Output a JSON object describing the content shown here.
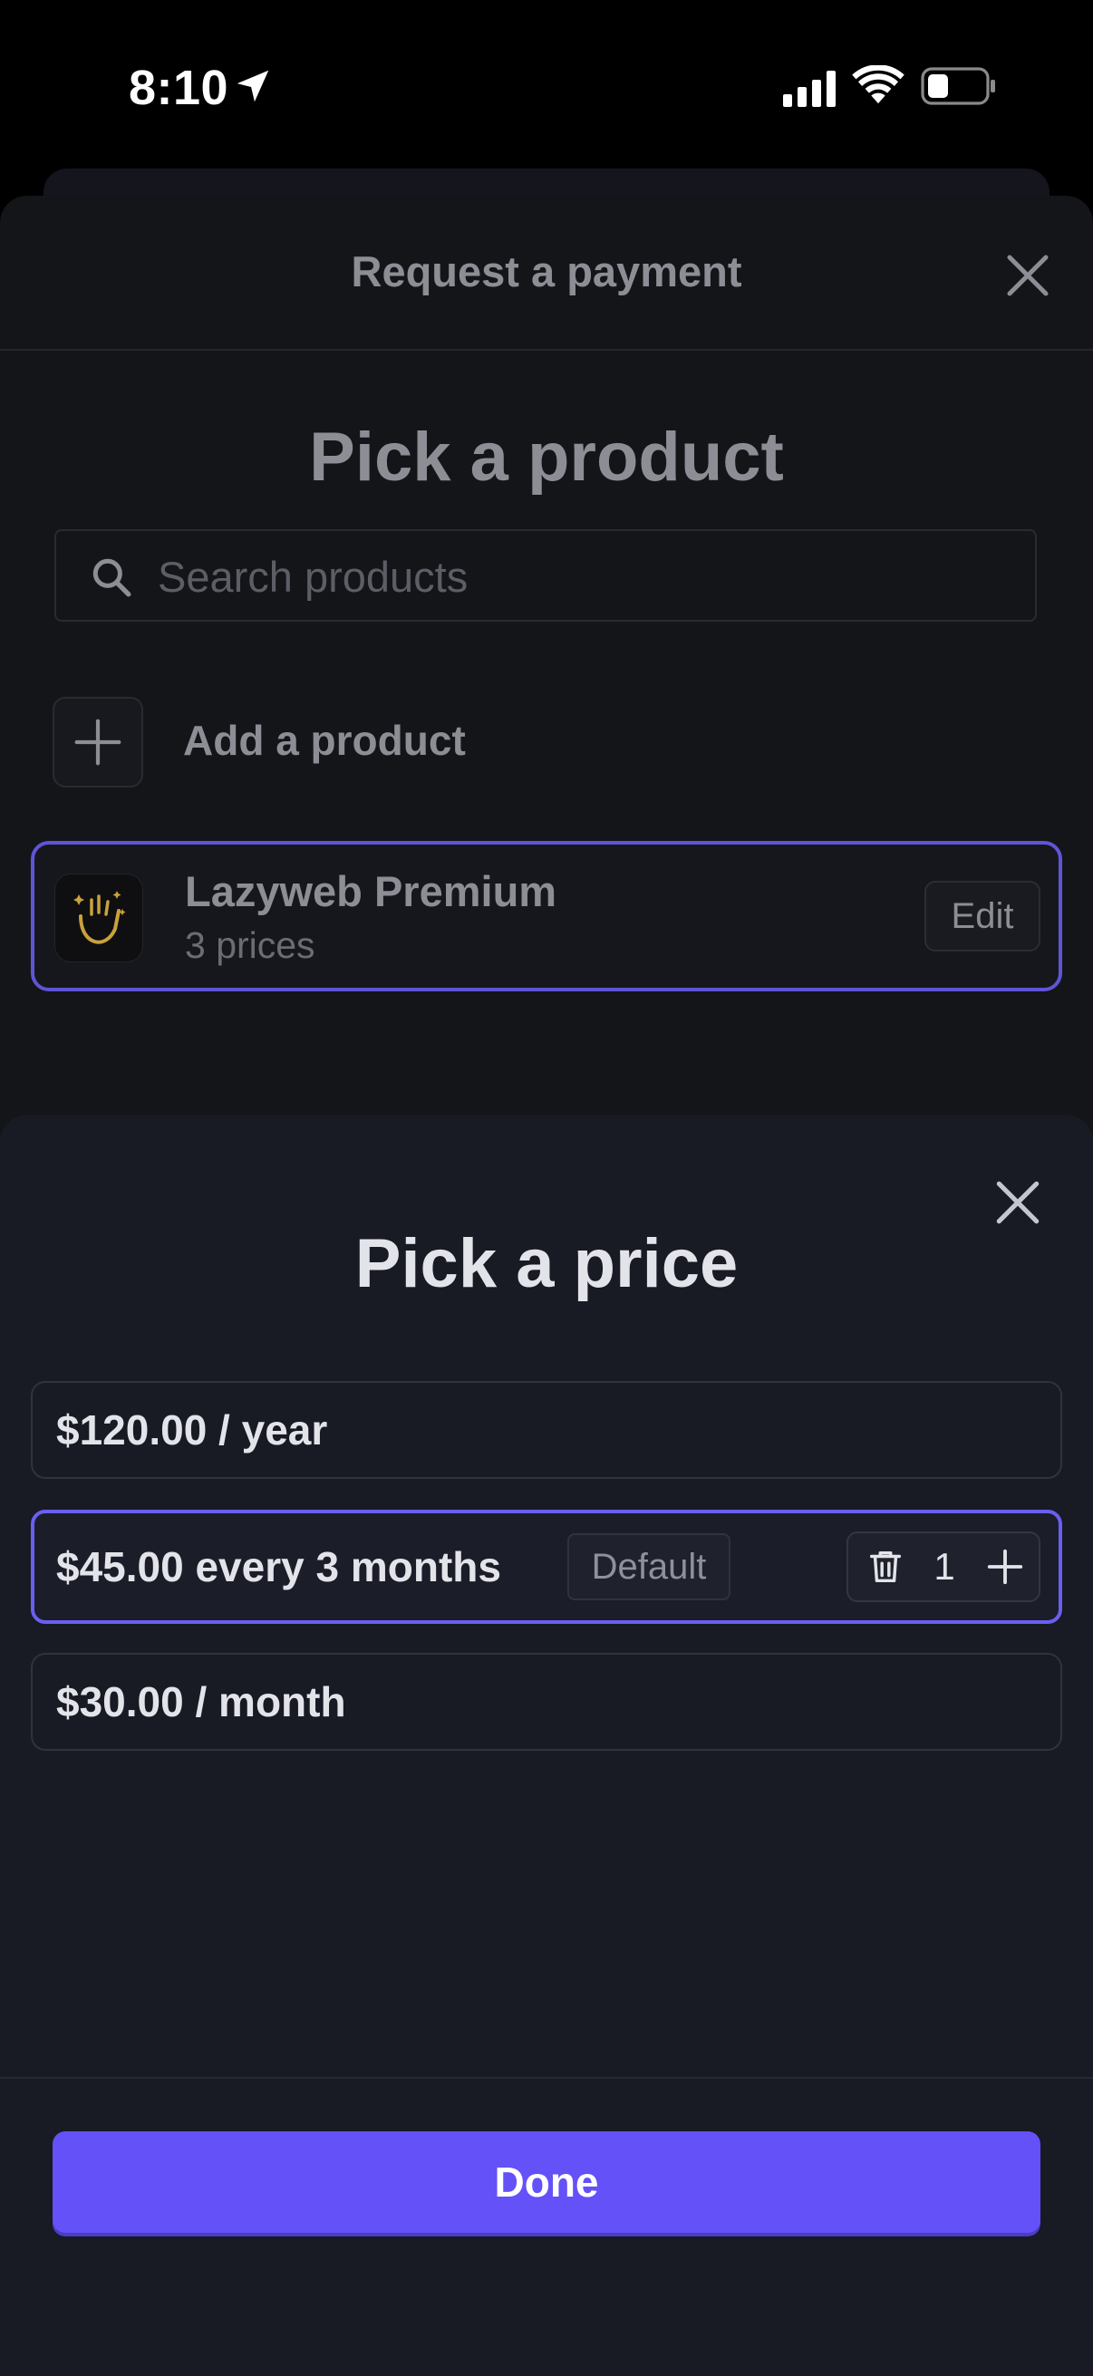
{
  "status_bar": {
    "time": "8:10"
  },
  "sheet1": {
    "title": "Request a payment",
    "heading": "Pick a product",
    "search": {
      "placeholder": "Search products",
      "value": ""
    },
    "add_product_label": "Add a product",
    "product": {
      "name": "Lazyweb Premium",
      "subtitle": "3 prices",
      "edit_label": "Edit"
    }
  },
  "sheet2": {
    "heading": "Pick a price",
    "prices": [
      {
        "label": "$120.00 / year"
      },
      {
        "label": "$45.00 every 3 months",
        "badge": "Default",
        "quantity": "1"
      },
      {
        "label": "$30.00 / month"
      }
    ],
    "done_label": "Done"
  },
  "colors": {
    "accent": "#6451f7",
    "selected_border": "#6a5ff0"
  }
}
